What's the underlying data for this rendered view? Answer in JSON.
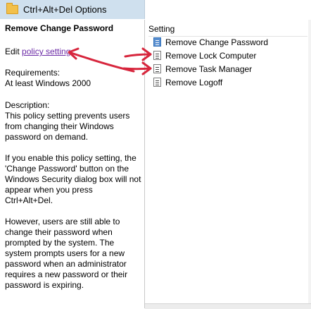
{
  "window": {
    "title": "Ctrl+Alt+Del Options"
  },
  "description_pane": {
    "heading": "Remove Change Password",
    "edit_prefix": "Edit ",
    "edit_link": "policy setting",
    "requirements_label": "Requirements:",
    "requirements_value": "At least Windows 2000",
    "description_label": "Description:",
    "paragraphs": [
      "This policy setting prevents users from changing their Windows password on demand.",
      "If you enable this policy setting, the 'Change Password' button on the Windows Security dialog box will not appear when you press Ctrl+Alt+Del.",
      "However, users are still able to change their password when prompted by the system. The system prompts users for a new password when an administrator requires a new password or their password is expiring."
    ]
  },
  "settings_pane": {
    "column_header": "Setting",
    "items": [
      {
        "label": "Remove Change Password",
        "icon": "policy-setting-icon",
        "selected": true
      },
      {
        "label": "Remove Lock Computer",
        "icon": "policy-setting-icon",
        "selected": false
      },
      {
        "label": "Remove Task Manager",
        "icon": "policy-setting-icon",
        "selected": false
      },
      {
        "label": "Remove Logoff",
        "icon": "policy-setting-icon",
        "selected": false
      }
    ]
  },
  "annotations": {
    "arrow_color": "#d7263d"
  }
}
